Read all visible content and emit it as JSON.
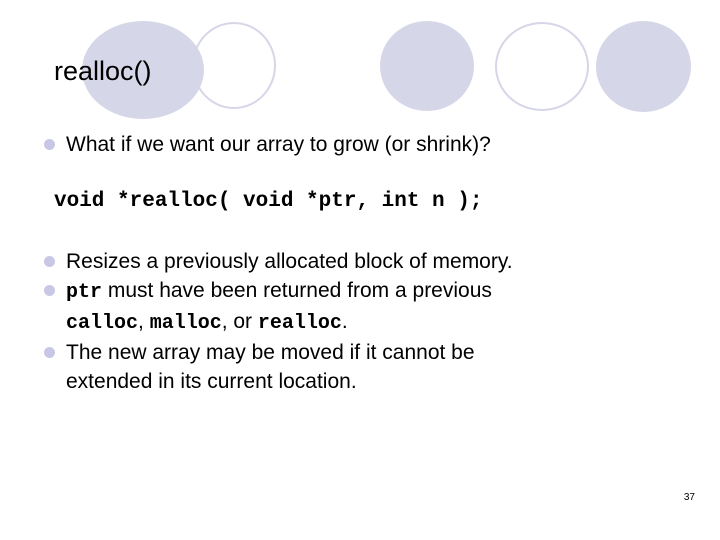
{
  "slide": {
    "title": "realloc()",
    "page_number": "37",
    "background_color": "#ffffff",
    "accent_color": "#d6d6e9",
    "bullet_color": "#c8c8e6",
    "text_color": "#000000"
  },
  "decoration": {
    "name": "header-circles",
    "circles": [
      {
        "style": "filled"
      },
      {
        "style": "outlined"
      },
      {
        "style": "filled"
      },
      {
        "style": "outlined"
      },
      {
        "style": "filled"
      }
    ]
  },
  "content": {
    "bullet1": "What if we want our array to grow (or shrink)?",
    "code": "void *realloc( void *ptr, int n );",
    "bullet2": "Resizes a previously allocated block of memory.",
    "bullet3": {
      "code_term": "ptr",
      "rest": " must have been returned from a previous"
    },
    "bullet3_continuation": {
      "term1": "calloc",
      "sep1": ", ",
      "term2": "malloc",
      "sep2": ", or ",
      "term3": "realloc",
      "sep3": "."
    },
    "bullet4_line1": "The new array may be moved if it cannot be",
    "bullet4_line2": "extended in its current location."
  }
}
